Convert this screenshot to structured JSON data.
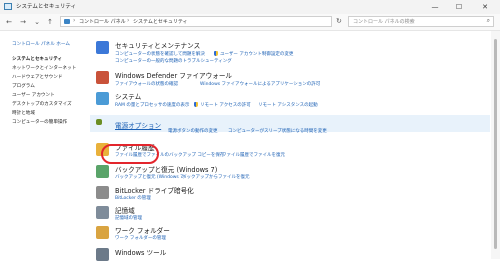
{
  "window": {
    "title": "システムとセキュリティ",
    "min": "—",
    "max": "☐",
    "close": "✕"
  },
  "nav": {
    "back": "←",
    "forward": "→",
    "down": "⌄",
    "up": "↑",
    "refresh": "↻"
  },
  "breadcrumb": [
    "コントロール パネル",
    "システムとセキュリティ"
  ],
  "search": {
    "placeholder": "コントロール パネルの検索"
  },
  "sidebar": {
    "items": [
      "コントロール パネル ホーム",
      "システムとセキュリティ",
      "ネットワークとインターネット",
      "ハードウェアとサウンド",
      "プログラム",
      "ユーザー アカウント",
      "デスクトップのカスタマイズ",
      "時計と地域",
      "コンピューターの簡単操作"
    ]
  },
  "categories": [
    {
      "title": "セキュリティとメンテナンス",
      "links": [
        "コンピューターの状態を確認して問題を解決",
        "ユーザー アカウント制御設定の変更"
      ],
      "links2": [
        "コンピューターの一般的な問題のトラブルシューティング"
      ]
    },
    {
      "title": "Windows Defender ファイアウォール",
      "links": [
        "ファイアウォールの状態の確認",
        "Windows ファイアウォールによるアプリケーションの許可"
      ],
      "links2": []
    },
    {
      "title": "システム",
      "links": [
        "RAM の量とプロセッサの速度の表示",
        "リモート アクセスの許可",
        "リモート アシスタンスの起動"
      ],
      "links2": []
    },
    {
      "title": "電源オプション",
      "links": [
        "電源ボタンの動作の変更",
        "コンピューターがスリープ状態になる時間を変更"
      ],
      "links2": []
    },
    {
      "title": "ファイル履歴",
      "links": [
        "ファイル履歴でファイルのバックアップ コピーを保存",
        "ファイル履歴でファイルを復元"
      ],
      "links2": []
    },
    {
      "title": "バックアップと復元 (Windows 7)",
      "links": [
        "バックアップと復元 (Windows 7)",
        "バックアップからファイルを復元"
      ],
      "links2": []
    },
    {
      "title": "BitLocker ドライブ暗号化",
      "links": [
        "BitLocker の管理"
      ],
      "links2": []
    },
    {
      "title": "記憶域",
      "links": [
        "記憶域の管理"
      ],
      "links2": []
    },
    {
      "title": "ワーク フォルダー",
      "links": [
        "ワーク フォルダーの管理"
      ],
      "links2": []
    },
    {
      "title": "Windows ツール",
      "links": [],
      "links2": []
    }
  ]
}
